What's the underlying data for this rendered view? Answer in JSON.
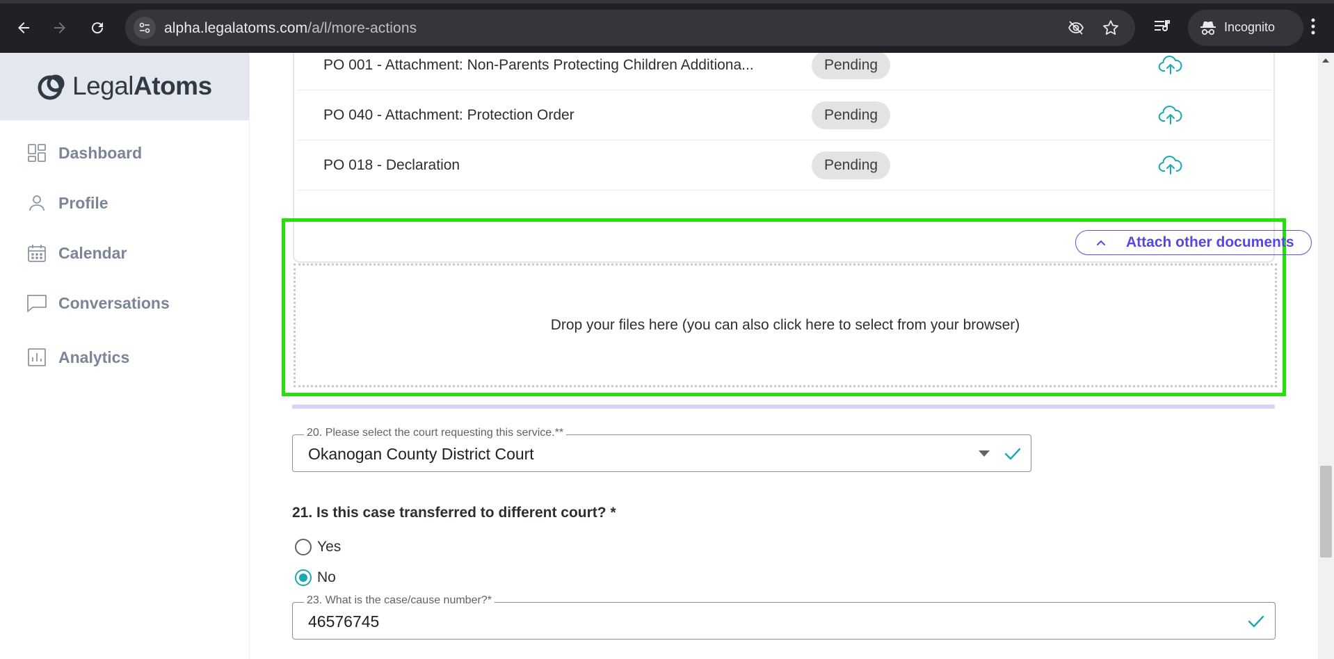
{
  "browser": {
    "url_host": "alpha.legalatoms.com",
    "url_path": "/a/l/more-actions",
    "incognito_label": "Incognito",
    "icons": [
      "back-icon",
      "forward-icon",
      "reload-icon",
      "site-info-icon",
      "eye-off-icon",
      "star-icon",
      "media-queue-icon",
      "incognito-icon",
      "more-vert-icon"
    ]
  },
  "sidebar": {
    "brand": {
      "light": "Legal",
      "bold": "Atoms"
    },
    "items": [
      {
        "label": "Dashboard",
        "icon": "grid-icon"
      },
      {
        "label": "Profile",
        "icon": "person-icon"
      },
      {
        "label": "Calendar",
        "icon": "calendar-icon"
      },
      {
        "label": "Conversations",
        "icon": "chat-icon"
      },
      {
        "label": "Analytics",
        "icon": "bar-chart-icon"
      }
    ]
  },
  "documents": {
    "rows": [
      {
        "name": "PO 001 - Attachment: Non-Parents Protecting Children Additiona...",
        "status": "Pending"
      },
      {
        "name": "PO 040 - Attachment: Protection Order",
        "status": "Pending"
      },
      {
        "name": "PO 018 - Declaration",
        "status": "Pending"
      }
    ],
    "upload_icon": "cloud-upload-icon"
  },
  "attach": {
    "button_label": "Attach other documents",
    "dropzone_text": "Drop your files here (you can also click here to select from your browser)"
  },
  "form": {
    "court": {
      "label": "20. Please select the court requesting this service.**",
      "value": "Okanogan County District Court"
    },
    "transfer": {
      "question": "21. Is this case transferred to different court? *",
      "options": [
        "Yes",
        "No"
      ],
      "selected": "No"
    },
    "case_number": {
      "label": "23. What is the case/cause number?*",
      "value": "46576745"
    }
  },
  "colors": {
    "accent_teal": "#1aa8b3",
    "accent_purple": "#5548e2",
    "highlight_green": "#27e00b"
  }
}
